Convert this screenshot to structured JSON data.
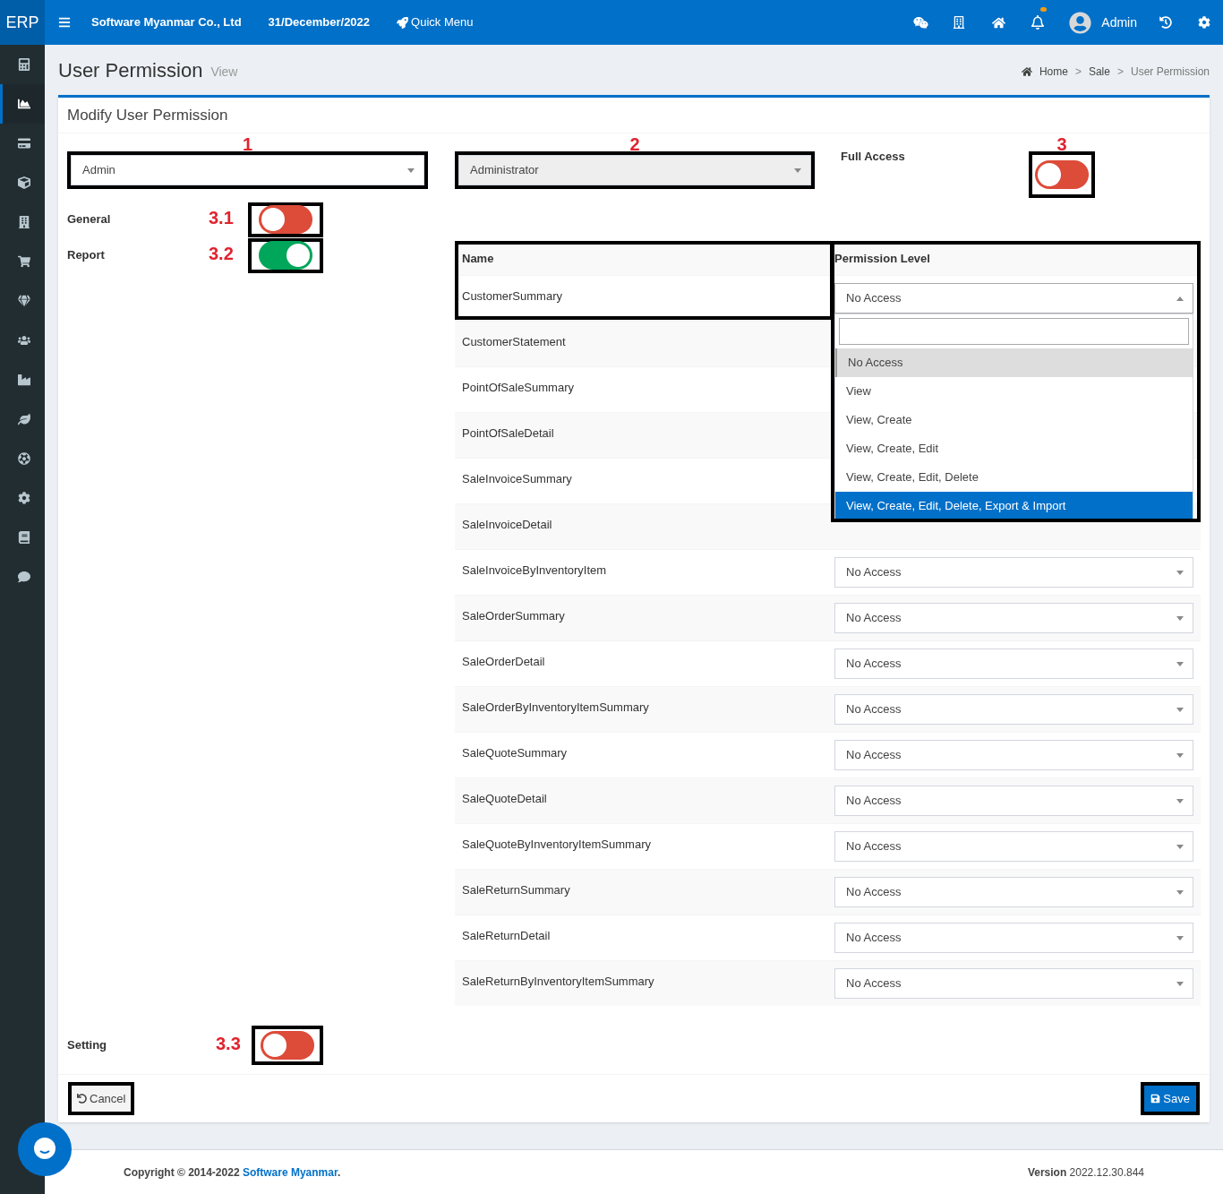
{
  "header": {
    "logo": "ERP",
    "company": "Software Myanmar Co., Ltd",
    "date": "31/December/2022",
    "quick_menu": "Quick Menu",
    "user": "Admin",
    "notification_dot": true
  },
  "sidebar": {
    "items": [
      {
        "selected": false
      },
      {
        "selected": true
      },
      {
        "selected": false
      },
      {
        "selected": false
      },
      {
        "selected": false
      },
      {
        "selected": false
      },
      {
        "selected": false
      },
      {
        "selected": false
      },
      {
        "selected": false
      },
      {
        "selected": false
      },
      {
        "selected": false
      },
      {
        "selected": false
      },
      {
        "selected": false
      },
      {
        "selected": false
      }
    ]
  },
  "page": {
    "title": "User Permission",
    "subtitle": "View",
    "breadcrumb": [
      "Home",
      "Sale",
      "User Permission"
    ],
    "breadcrumb_separators": [
      ">",
      ">"
    ]
  },
  "form": {
    "title": "Modify User Permission",
    "user_select": {
      "value": "Admin",
      "disabled": false,
      "annotation": "1"
    },
    "role_select": {
      "value": "Administrator",
      "disabled": true,
      "annotation": "2"
    },
    "full_access": {
      "label": "Full Access",
      "on": false,
      "annotation": "3"
    },
    "sections": [
      {
        "label": "General",
        "on": false,
        "annotation": "3.1"
      },
      {
        "label": "Report",
        "on": true,
        "annotation": "3.2"
      }
    ],
    "setting": {
      "label": "Setting",
      "on": false,
      "annotation": "3.3"
    },
    "table": {
      "columns": [
        "Name",
        "Permission Level"
      ],
      "rows": [
        {
          "name": "CustomerSummary",
          "permission": "No Access",
          "open": true
        },
        {
          "name": "CustomerStatement"
        },
        {
          "name": "PointOfSaleSummary"
        },
        {
          "name": "PointOfSaleDetail"
        },
        {
          "name": "SaleInvoiceSummary"
        },
        {
          "name": "SaleInvoiceDetail"
        },
        {
          "name": "SaleInvoiceByInventoryItem",
          "permission": "No Access",
          "open": false
        },
        {
          "name": "SaleOrderSummary",
          "permission": "No Access",
          "open": false
        },
        {
          "name": "SaleOrderDetail",
          "permission": "No Access",
          "open": false
        },
        {
          "name": "SaleOrderByInventoryItemSummary",
          "permission": "No Access",
          "open": false
        },
        {
          "name": "SaleQuoteSummary",
          "permission": "No Access",
          "open": false
        },
        {
          "name": "SaleQuoteDetail",
          "permission": "No Access",
          "open": false
        },
        {
          "name": "SaleQuoteByInventoryItemSummary",
          "permission": "No Access",
          "open": false
        },
        {
          "name": "SaleReturnSummary",
          "permission": "No Access",
          "open": false
        },
        {
          "name": "SaleReturnDetail",
          "permission": "No Access",
          "open": false
        },
        {
          "name": "SaleReturnByInventoryItemSummary",
          "permission": "No Access",
          "open": false
        }
      ],
      "dropdown_options": [
        {
          "label": "No Access",
          "selected": true,
          "highlighted": false
        },
        {
          "label": "View",
          "selected": false,
          "highlighted": false
        },
        {
          "label": "View, Create",
          "selected": false,
          "highlighted": false
        },
        {
          "label": "View, Create, Edit",
          "selected": false,
          "highlighted": false
        },
        {
          "label": "View, Create, Edit, Delete",
          "selected": false,
          "highlighted": false
        },
        {
          "label": "View, Create, Edit, Delete, Export & Import",
          "selected": false,
          "highlighted": true
        }
      ]
    },
    "buttons": {
      "cancel": "Cancel",
      "save": "Save"
    }
  },
  "footer": {
    "copyright": "Copyright © 2014-2022",
    "company": "Software Myanmar",
    "period": ".",
    "version_label": "Version",
    "version": "2022.12.30.844"
  }
}
